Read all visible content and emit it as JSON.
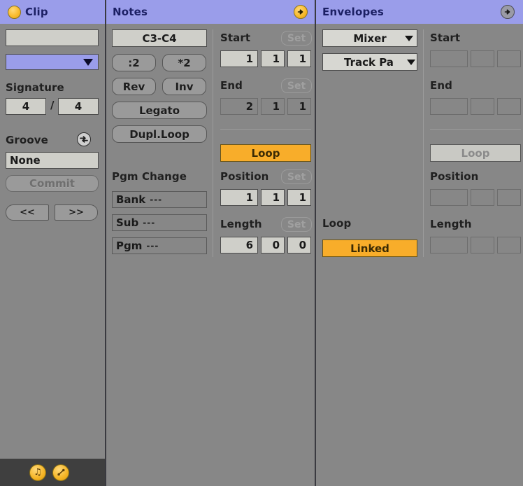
{
  "window": {
    "bg_color": "#878787",
    "header_color": "#9a9dea",
    "accent_color": "#f8ad2a"
  },
  "header": {
    "clip": {
      "title": "Clip",
      "dot_icon": "clip-color-dot"
    },
    "notes": {
      "title": "Notes",
      "toggle_icon": "arrow-right-circle",
      "toggle_active": true
    },
    "envelopes": {
      "title": "Envelopes",
      "toggle_icon": "arrow-right-circle",
      "toggle_active": false
    }
  },
  "clip_panel": {
    "name_field_value": "",
    "name_field_placeholder": "",
    "color_swatch": "#9a9dea",
    "signature_label": "Signature",
    "signature_numerator": "4",
    "signature_denominator": "4",
    "signature_divider": "/",
    "groove_label": "Groove",
    "groove_icon": "hot-swap-icon",
    "groove_value": "None",
    "commit_label": "Commit",
    "prev_label": "<<",
    "next_label": ">>",
    "footer_icons": [
      {
        "name": "midi-note-icon",
        "glyph": "♫"
      },
      {
        "name": "envelope-automation-icon",
        "glyph": "⤧"
      }
    ]
  },
  "notes_panel": {
    "range_label": "C3-C4",
    "buttons": [
      {
        "name": "halve-button",
        "label": ":2"
      },
      {
        "name": "double-button",
        "label": "*2"
      },
      {
        "name": "reverse-button",
        "label": "Rev"
      },
      {
        "name": "invert-button",
        "label": "Inv"
      }
    ],
    "legato_label": "Legato",
    "dupl_loop_label": "Dupl.Loop",
    "pgm_change_label": "Pgm Change",
    "pgm_rows": [
      {
        "name": "bank-field",
        "label": "Bank",
        "value": "---"
      },
      {
        "name": "sub-field",
        "label": "Sub",
        "value": "---"
      },
      {
        "name": "pgm-field",
        "label": "Pgm",
        "value": "---"
      }
    ],
    "start": {
      "label": "Start",
      "set_label": "Set",
      "bars": "1",
      "beats": "1",
      "sixteenths": "1"
    },
    "end": {
      "label": "End",
      "set_label": "Set",
      "bars": "2",
      "beats": "1",
      "sixteenths": "1"
    },
    "loop_label": "Loop",
    "loop_enabled": true,
    "position": {
      "label": "Position",
      "set_label": "Set",
      "bars": "1",
      "beats": "1",
      "sixteenths": "1"
    },
    "length": {
      "label": "Length",
      "set_label": "Set",
      "bars": "6",
      "beats": "0",
      "sixteenths": "0"
    }
  },
  "envelopes_panel": {
    "device_selector": "Mixer",
    "parameter_selector": "Track Pa",
    "loop_label": "Loop",
    "linked_label": "Linked",
    "linked_enabled": true,
    "start": {
      "label": "Start",
      "bars": "",
      "beats": "",
      "sixteenths": ""
    },
    "end": {
      "label": "End",
      "bars": "",
      "beats": "",
      "sixteenths": ""
    },
    "loop_button_label": "Loop",
    "position": {
      "label": "Position",
      "bars": "",
      "beats": "",
      "sixteenths": ""
    },
    "length": {
      "label": "Length",
      "bars": "",
      "beats": "",
      "sixteenths": ""
    }
  }
}
